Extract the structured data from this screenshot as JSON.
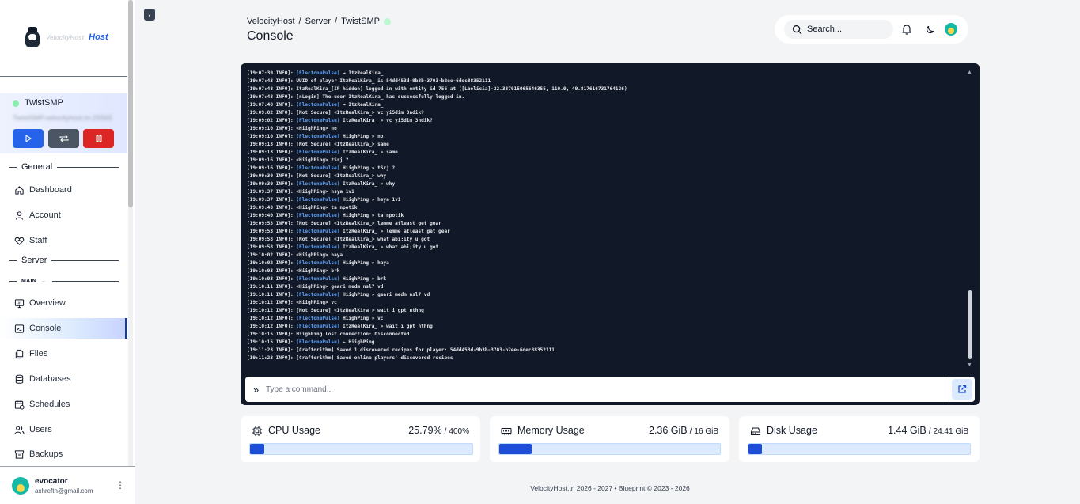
{
  "brand": {
    "logo_small": "VelocityHost",
    "logo_host": "Host"
  },
  "server_card": {
    "name": "TwistSMP",
    "address": "TwistSMP.velocityhost.tn:25565",
    "status_color": "#86efac"
  },
  "sections": {
    "general": "General",
    "server": "Server",
    "main": "MAIN"
  },
  "nav": {
    "dashboard": "Dashboard",
    "account": "Account",
    "staff": "Staff",
    "overview": "Overview",
    "console": "Console",
    "files": "Files",
    "databases": "Databases",
    "schedules": "Schedules",
    "users": "Users",
    "backups": "Backups"
  },
  "user": {
    "name": "evocator",
    "email": "axhreftn@gmail.com"
  },
  "breadcrumb": {
    "host": "VelocityHost",
    "sep": "/",
    "server": "Server",
    "name": "TwistSMP"
  },
  "page_title": "Console",
  "search": {
    "placeholder": "Search..."
  },
  "console": {
    "lines": [
      {
        "t": "[19:07:39 INFO]: ",
        "p": "(FlectonePulse)",
        "m": " → ItzRealKira_"
      },
      {
        "t": "[19:07:43 INFO]: ",
        "p": "",
        "m": "UUID of player ItzRealKira_ is 54dd453d-9b3b-3703-b2ee-6dec88352111"
      },
      {
        "t": "[19:07:48 INFO]: ",
        "p": "",
        "m": "ItzRealKira_[IP hidden] logged in with entity id 756 at ([Lbolicia]-22.337015065646355, 110.0, 49.817616731764136)"
      },
      {
        "t": "[19:07:48 INFO]: ",
        "p": "",
        "m": "[nLogin] The user ItzRealKira_ has successfully logged in."
      },
      {
        "t": "[19:07:48 INFO]: ",
        "p": "(FlectonePulse)",
        "m": " → ItzRealKira_"
      },
      {
        "t": "[19:09:02 INFO]: ",
        "p": "",
        "m": "[Not Secure] <ItzRealKira_> vc yi5dim 3ndik?"
      },
      {
        "t": "[19:09:02 INFO]: ",
        "p": "(FlectonePulse)",
        "m": " ItzRealKira_ » vc yi5dim 3ndik?"
      },
      {
        "t": "[19:09:10 INFO]: ",
        "p": "",
        "m": "<HiighPing> no"
      },
      {
        "t": "[19:09:10 INFO]: ",
        "p": "(FlectonePulse)",
        "m": " HiighPing » no"
      },
      {
        "t": "[19:09:13 INFO]: ",
        "p": "",
        "m": "[Not Secure] <ItzRealKira_> same"
      },
      {
        "t": "[19:09:13 INFO]: ",
        "p": "(FlectonePulse)",
        "m": " ItzRealKira_ » same"
      },
      {
        "t": "[19:09:16 INFO]: ",
        "p": "",
        "m": "<HiighPing> tSrj ?"
      },
      {
        "t": "[19:09:16 INFO]: ",
        "p": "(FlectonePulse)",
        "m": " HiighPing » tSrj ?"
      },
      {
        "t": "[19:09:30 INFO]: ",
        "p": "",
        "m": "[Not Secure] <ItzRealKira_> why"
      },
      {
        "t": "[19:09:30 INFO]: ",
        "p": "(FlectonePulse)",
        "m": " ItzRealKira_ » why"
      },
      {
        "t": "[19:09:37 INFO]: ",
        "p": "",
        "m": "<HiighPing> hsya 1v1"
      },
      {
        "t": "[19:09:37 INFO]: ",
        "p": "(FlectonePulse)",
        "m": " HiighPing » hsya 1v1"
      },
      {
        "t": "[19:09:40 INFO]: ",
        "p": "",
        "m": "<HiighPing> ta npotik"
      },
      {
        "t": "[19:09:40 INFO]: ",
        "p": "(FlectonePulse)",
        "m": " HiighPing » ta npotik"
      },
      {
        "t": "[19:09:53 INFO]: ",
        "p": "",
        "m": "[Not Secure] <ItzRealKira_> lemme atleast get gear"
      },
      {
        "t": "[19:09:53 INFO]: ",
        "p": "(FlectonePulse)",
        "m": " ItzRealKira_ » lemme atleast get gear"
      },
      {
        "t": "[19:09:58 INFO]: ",
        "p": "",
        "m": "[Not Secure] <ItzRealKira_> what abi;ity u got"
      },
      {
        "t": "[19:09:58 INFO]: ",
        "p": "(FlectonePulse)",
        "m": " ItzRealKira_ » what abi;ity u got"
      },
      {
        "t": "[19:10:02 INFO]: ",
        "p": "",
        "m": "<HiighPing> haya"
      },
      {
        "t": "[19:10:02 INFO]: ",
        "p": "(FlectonePulse)",
        "m": " HiighPing » haya"
      },
      {
        "t": "[19:10:03 INFO]: ",
        "p": "",
        "m": "<HiighPing> brk"
      },
      {
        "t": "[19:10:03 INFO]: ",
        "p": "(FlectonePulse)",
        "m": " HiighPing » brk"
      },
      {
        "t": "[19:10:11 INFO]: ",
        "p": "",
        "m": "<HiighPing> geari medm nsl7 vd"
      },
      {
        "t": "[19:10:11 INFO]: ",
        "p": "(FlectonePulse)",
        "m": " HiighPing » geari medm nsl7 vd"
      },
      {
        "t": "[19:10:12 INFO]: ",
        "p": "",
        "m": "<HiighPing> vc"
      },
      {
        "t": "[19:10:12 INFO]: ",
        "p": "",
        "m": "[Not Secure] <ItzRealKira_> wait i gpt nthng"
      },
      {
        "t": "[19:10:12 INFO]: ",
        "p": "(FlectonePulse)",
        "m": " HiighPing » vc"
      },
      {
        "t": "[19:10:12 INFO]: ",
        "p": "(FlectonePulse)",
        "m": " ItzRealKira_ » wait i gpt nthng"
      },
      {
        "t": "[19:10:15 INFO]: ",
        "p": "",
        "m": "HiighPing lost connection: Disconnected"
      },
      {
        "t": "[19:10:15 INFO]: ",
        "p": "(FlectonePulse)",
        "m": " ← HiighPing"
      },
      {
        "t": "[19:11:23 INFO]: ",
        "p": "",
        "m": "[Craftorithm] Saved 1 discovered recipes for player: 54dd453d-9b3b-3703-b2ee-6dec88352111"
      },
      {
        "t": "[19:11:23 INFO]: ",
        "p": "",
        "m": "[Craftorithm] Saved online players' discovered recipes"
      }
    ],
    "command_placeholder": "Type a command..."
  },
  "stats": {
    "cpu": {
      "label": "CPU Usage",
      "value": "25.79%",
      "sep": "/",
      "max": "400%",
      "fraction": 0.0645
    },
    "memory": {
      "label": "Memory Usage",
      "value": "2.36 GiB",
      "sep": "/",
      "max": "16 GiB",
      "fraction": 0.1475
    },
    "disk": {
      "label": "Disk Usage",
      "value": "1.44 GiB",
      "sep": "/",
      "max": "24.41 GiB",
      "fraction": 0.059
    }
  },
  "footer": "VelocityHost.tn 2026 - 2027   •   Blueprint © 2023 - 2026",
  "colors": {
    "accent": "#1d4ed8",
    "console_bg": "#111827",
    "plugin_tag": "#60a5fa",
    "stop": "#dc2626",
    "start": "#2563eb"
  }
}
